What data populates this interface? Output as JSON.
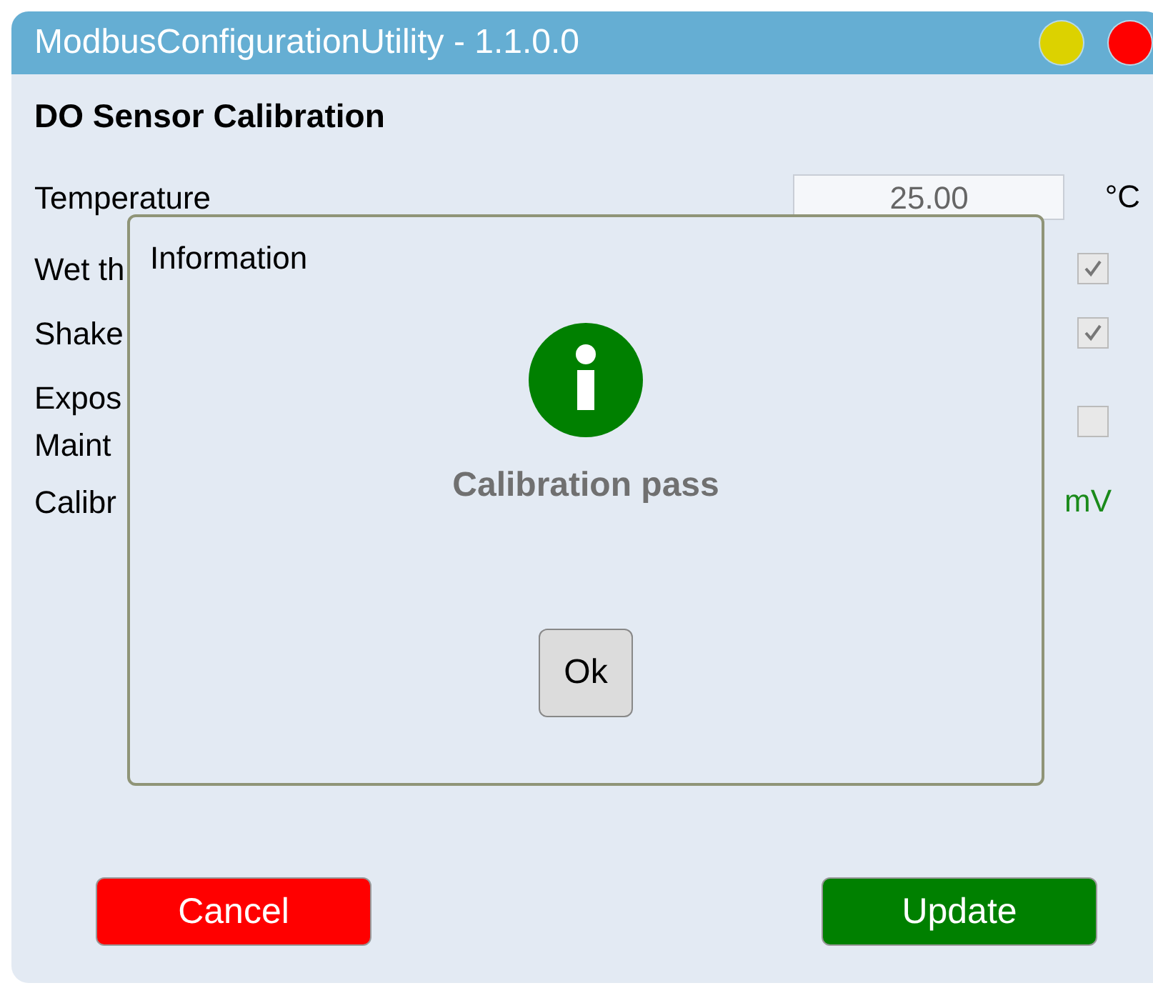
{
  "window": {
    "title": "ModbusConfigurationUtility - 1.1.0.0",
    "controls": [
      {
        "color": "#dcd200"
      },
      {
        "color": "#ff0000"
      }
    ]
  },
  "heading": "DO Sensor Calibration",
  "rows": [
    {
      "kind": "input",
      "label": "Temperature",
      "value": "25.00",
      "unit": "°C"
    },
    {
      "kind": "checkbox",
      "label": "Wet th",
      "checked": true
    },
    {
      "kind": "checkbox",
      "label": "Shake",
      "checked": true
    },
    {
      "kind": "checkbox",
      "label": "Expos",
      "label_2": "Maint",
      "checked": false
    },
    {
      "kind": "reading",
      "label": "Calibr",
      "unit": "mV"
    }
  ],
  "buttons": [
    {
      "label": "Cancel",
      "color": "#ff0000"
    },
    {
      "label": "Update",
      "color": "#008000"
    }
  ],
  "dialog": {
    "title": "Information",
    "message": "Calibration pass",
    "button": "Ok"
  }
}
